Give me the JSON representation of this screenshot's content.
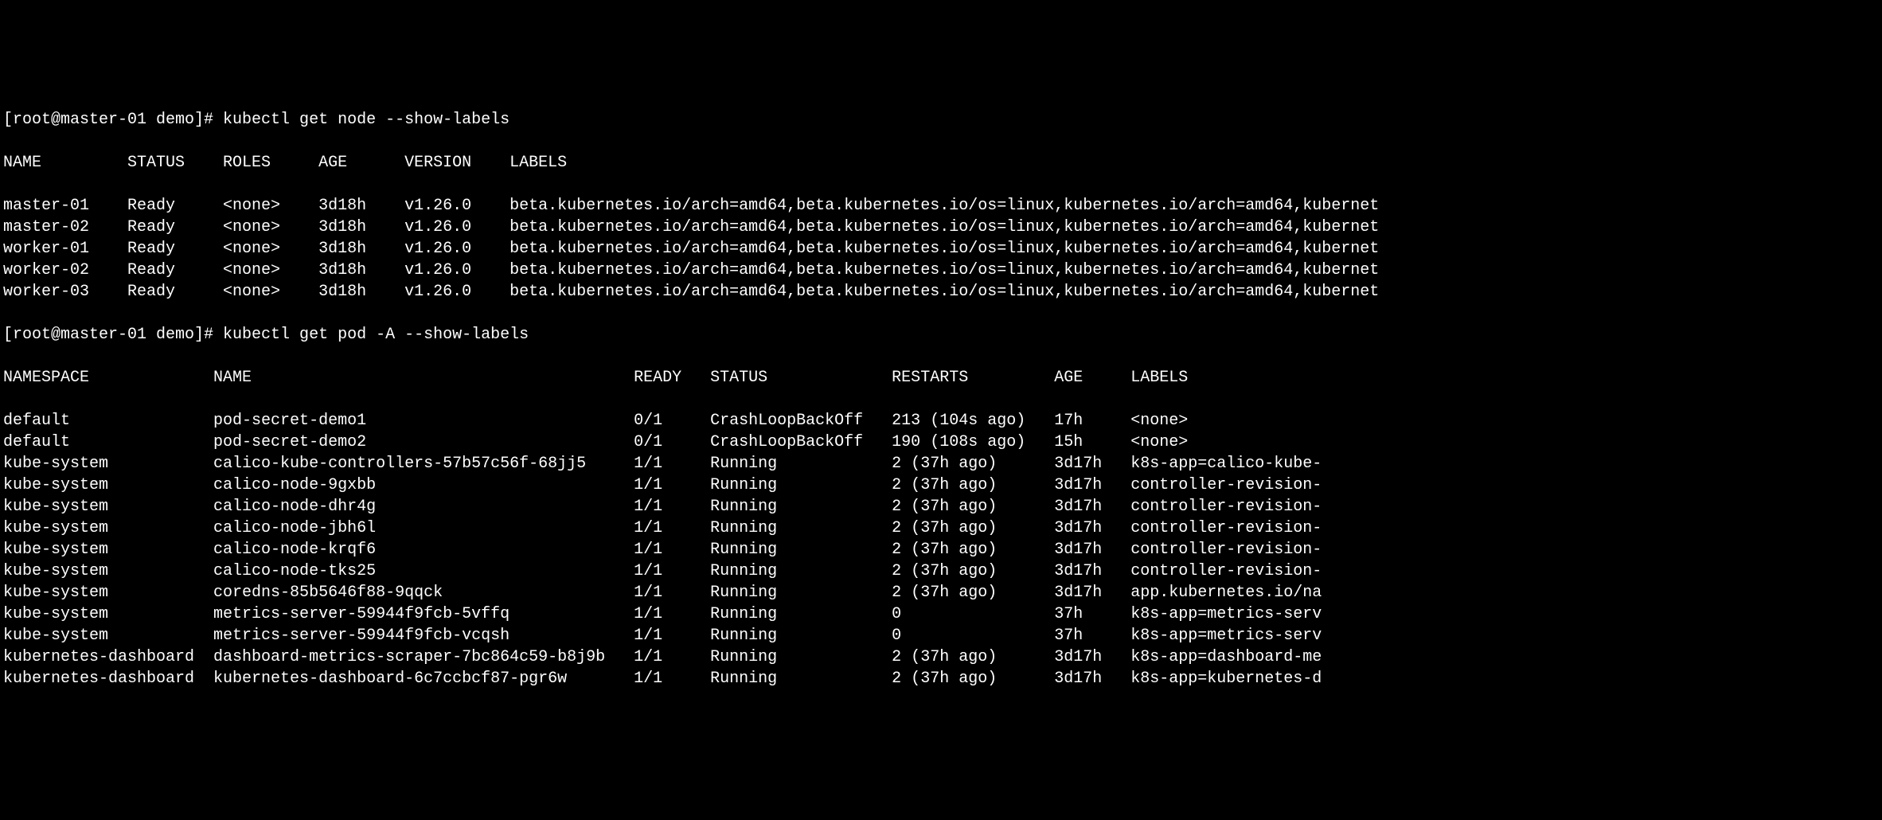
{
  "prompt1": "[root@master-01 demo]# kubectl get node --show-labels",
  "node_header": {
    "name": "NAME",
    "status": "STATUS",
    "roles": "ROLES",
    "age": "AGE",
    "version": "VERSION",
    "labels": "LABELS"
  },
  "nodes": [
    {
      "name": "master-01",
      "status": "Ready",
      "roles": "<none>",
      "age": "3d18h",
      "version": "v1.26.0",
      "labels": "beta.kubernetes.io/arch=amd64,beta.kubernetes.io/os=linux,kubernetes.io/arch=amd64,kubernet"
    },
    {
      "name": "master-02",
      "status": "Ready",
      "roles": "<none>",
      "age": "3d18h",
      "version": "v1.26.0",
      "labels": "beta.kubernetes.io/arch=amd64,beta.kubernetes.io/os=linux,kubernetes.io/arch=amd64,kubernet"
    },
    {
      "name": "worker-01",
      "status": "Ready",
      "roles": "<none>",
      "age": "3d18h",
      "version": "v1.26.0",
      "labels": "beta.kubernetes.io/arch=amd64,beta.kubernetes.io/os=linux,kubernetes.io/arch=amd64,kubernet"
    },
    {
      "name": "worker-02",
      "status": "Ready",
      "roles": "<none>",
      "age": "3d18h",
      "version": "v1.26.0",
      "labels": "beta.kubernetes.io/arch=amd64,beta.kubernetes.io/os=linux,kubernetes.io/arch=amd64,kubernet"
    },
    {
      "name": "worker-03",
      "status": "Ready",
      "roles": "<none>",
      "age": "3d18h",
      "version": "v1.26.0",
      "labels": "beta.kubernetes.io/arch=amd64,beta.kubernetes.io/os=linux,kubernetes.io/arch=amd64,kubernet"
    }
  ],
  "prompt2": "[root@master-01 demo]# kubectl get pod -A --show-labels",
  "pod_header": {
    "namespace": "NAMESPACE",
    "name": "NAME",
    "ready": "READY",
    "status": "STATUS",
    "restarts": "RESTARTS",
    "age": "AGE",
    "labels": "LABELS"
  },
  "pods": [
    {
      "namespace": "default",
      "name": "pod-secret-demo1",
      "ready": "0/1",
      "status": "CrashLoopBackOff",
      "restarts": "213 (104s ago)",
      "age": "17h",
      "labels": "<none>"
    },
    {
      "namespace": "default",
      "name": "pod-secret-demo2",
      "ready": "0/1",
      "status": "CrashLoopBackOff",
      "restarts": "190 (108s ago)",
      "age": "15h",
      "labels": "<none>"
    },
    {
      "namespace": "kube-system",
      "name": "calico-kube-controllers-57b57c56f-68jj5",
      "ready": "1/1",
      "status": "Running",
      "restarts": "2 (37h ago)",
      "age": "3d17h",
      "labels": "k8s-app=calico-kube-"
    },
    {
      "namespace": "kube-system",
      "name": "calico-node-9gxbb",
      "ready": "1/1",
      "status": "Running",
      "restarts": "2 (37h ago)",
      "age": "3d17h",
      "labels": "controller-revision-"
    },
    {
      "namespace": "kube-system",
      "name": "calico-node-dhr4g",
      "ready": "1/1",
      "status": "Running",
      "restarts": "2 (37h ago)",
      "age": "3d17h",
      "labels": "controller-revision-"
    },
    {
      "namespace": "kube-system",
      "name": "calico-node-jbh6l",
      "ready": "1/1",
      "status": "Running",
      "restarts": "2 (37h ago)",
      "age": "3d17h",
      "labels": "controller-revision-"
    },
    {
      "namespace": "kube-system",
      "name": "calico-node-krqf6",
      "ready": "1/1",
      "status": "Running",
      "restarts": "2 (37h ago)",
      "age": "3d17h",
      "labels": "controller-revision-"
    },
    {
      "namespace": "kube-system",
      "name": "calico-node-tks25",
      "ready": "1/1",
      "status": "Running",
      "restarts": "2 (37h ago)",
      "age": "3d17h",
      "labels": "controller-revision-"
    },
    {
      "namespace": "kube-system",
      "name": "coredns-85b5646f88-9qqck",
      "ready": "1/1",
      "status": "Running",
      "restarts": "2 (37h ago)",
      "age": "3d17h",
      "labels": "app.kubernetes.io/na"
    },
    {
      "namespace": "kube-system",
      "name": "metrics-server-59944f9fcb-5vffq",
      "ready": "1/1",
      "status": "Running",
      "restarts": "0",
      "age": "37h",
      "labels": "k8s-app=metrics-serv"
    },
    {
      "namespace": "kube-system",
      "name": "metrics-server-59944f9fcb-vcqsh",
      "ready": "1/1",
      "status": "Running",
      "restarts": "0",
      "age": "37h",
      "labels": "k8s-app=metrics-serv"
    },
    {
      "namespace": "kubernetes-dashboard",
      "name": "dashboard-metrics-scraper-7bc864c59-b8j9b",
      "ready": "1/1",
      "status": "Running",
      "restarts": "2 (37h ago)",
      "age": "3d17h",
      "labels": "k8s-app=dashboard-me"
    },
    {
      "namespace": "kubernetes-dashboard",
      "name": "kubernetes-dashboard-6c7ccbcf87-pgr6w",
      "ready": "1/1",
      "status": "Running",
      "restarts": "2 (37h ago)",
      "age": "3d17h",
      "labels": "k8s-app=kubernetes-d"
    }
  ]
}
